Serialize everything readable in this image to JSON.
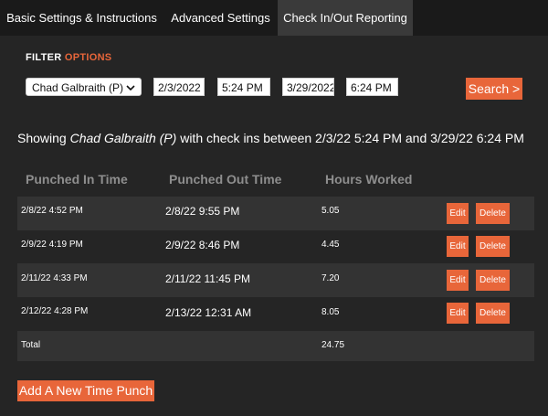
{
  "tabs": [
    {
      "label": "Basic Settings & Instructions"
    },
    {
      "label": "Advanced Settings"
    },
    {
      "label": "Check In/Out Reporting"
    }
  ],
  "filter": {
    "title_prefix": "FILTER",
    "title_accent": "OPTIONS",
    "person": "Chad Galbraith (P)",
    "start_date": "2/3/2022",
    "start_time": "5:24 PM",
    "end_date": "3/29/2022",
    "end_time": "6:24 PM",
    "search_label": "Search >"
  },
  "summary": {
    "prefix": "Showing ",
    "name": "Chad Galbraith (P)",
    "suffix": " with check ins between 2/3/22 5:24 PM and 3/29/22 6:24 PM"
  },
  "table": {
    "headers": [
      "Punched In Time",
      "Punched Out Time",
      "Hours Worked"
    ],
    "rows": [
      {
        "in": "2/8/22 4:52 PM",
        "out": "2/8/22 9:55 PM",
        "hours": "5.05",
        "edit": "Edit",
        "delete": "Delete"
      },
      {
        "in": "2/9/22 4:19 PM",
        "out": "2/9/22 8:46 PM",
        "hours": "4.45",
        "edit": "Edit",
        "delete": "Delete"
      },
      {
        "in": "2/11/22 4:33 PM",
        "out": "2/11/22 11:45 PM",
        "hours": "7.20",
        "edit": "Edit",
        "delete": "Delete"
      },
      {
        "in": "2/12/22 4:28 PM",
        "out": "2/13/22 12:31 AM",
        "hours": "8.05",
        "edit": "Edit",
        "delete": "Delete"
      }
    ],
    "total_label": "Total",
    "total_hours": "24.75"
  },
  "add_button_label": "Add A New Time Punch",
  "colors": {
    "accent": "#e8663a",
    "background": "#252525",
    "row_alt": "#333333"
  },
  "icons": {
    "select": "chevron-down-icon"
  }
}
